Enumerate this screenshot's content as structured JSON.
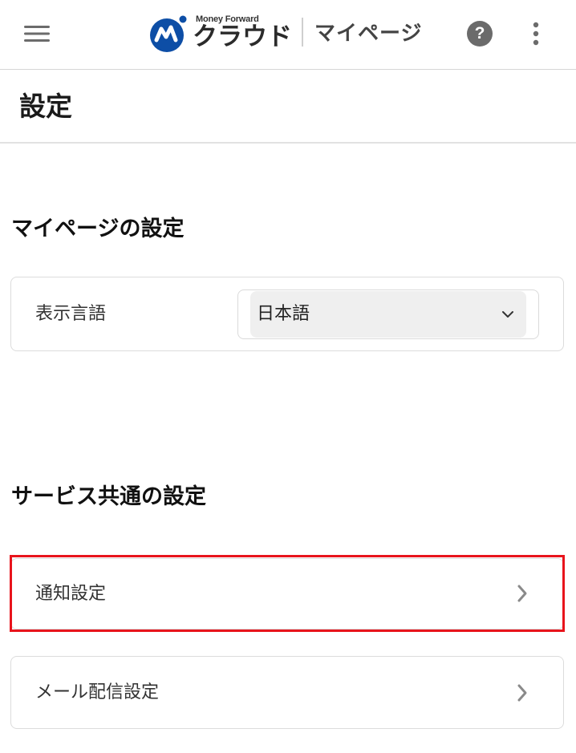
{
  "header": {
    "menu_icon": "hamburger-menu-icon",
    "logo_brand": "Money Forward",
    "logo_cloud": "クラウド",
    "logo_page": "マイページ",
    "help_label": "?",
    "help_icon": "help-circle-icon",
    "more_icon": "more-vertical-icon",
    "brand_color": "#0d4ea6"
  },
  "page": {
    "title": "設定"
  },
  "mypage_settings": {
    "heading": "マイページの設定",
    "language_label": "表示言語",
    "language_value": "日本語",
    "language_icon": "chevron-down-icon"
  },
  "common_settings": {
    "heading": "サービス共通の設定",
    "items": [
      {
        "label": "通知設定",
        "icon": "chevron-right-icon",
        "highlighted": true
      },
      {
        "label": "メール配信設定",
        "icon": "chevron-right-icon",
        "highlighted": false
      }
    ]
  },
  "colors": {
    "highlight": "#e8141c",
    "border": "#dcdcdc",
    "select_fill": "#efefef"
  }
}
